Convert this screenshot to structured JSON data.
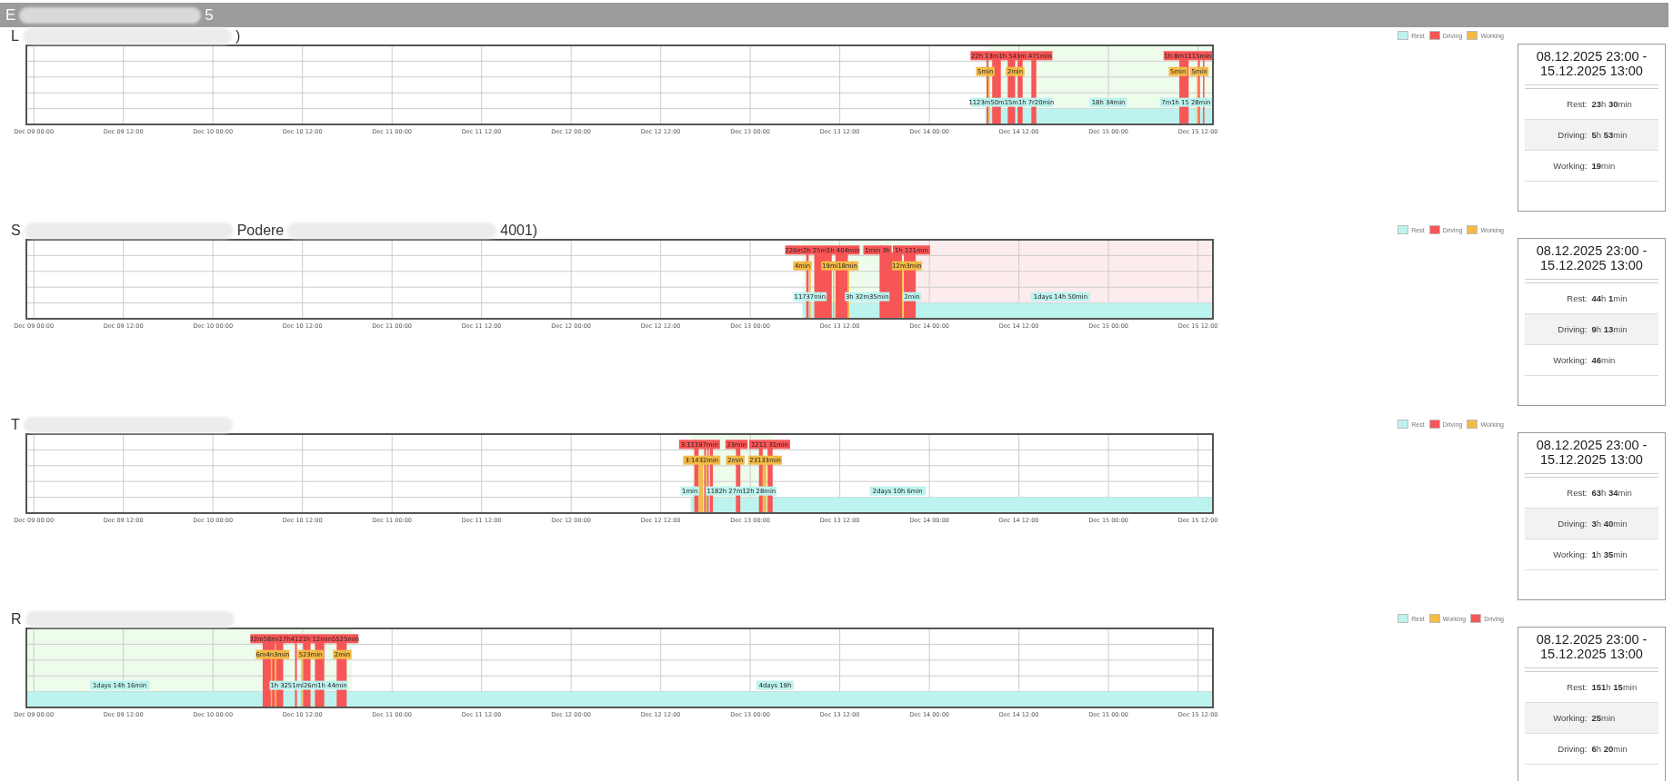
{
  "header": {
    "title": [
      {
        "kind": "text",
        "text": "E"
      },
      {
        "kind": "redaction"
      },
      {
        "kind": "text",
        "text": "5"
      }
    ]
  },
  "sections": [
    {
      "title": [
        {
          "kind": "text",
          "text": "L"
        },
        {
          "kind": "redaction"
        },
        {
          "kind": "text",
          "text": ")"
        }
      ],
      "legend": [
        {
          "kind": "rest",
          "label": "Rest"
        },
        {
          "kind": "driving",
          "label": "Driving"
        },
        {
          "kind": "working",
          "label": "Working"
        }
      ],
      "timeline": {
        "ticks": [
          "Dec 09 00:00",
          "Dec 09 12:00",
          "Dec 10 00:00",
          "Dec 10 12:00",
          "Dec 11 00:00",
          "Dec 11 12:00",
          "Dec 12 00:00",
          "Dec 12 12:00",
          "Dec 13 00:00",
          "Dec 13 12:00",
          "Dec 14 00:00",
          "Dec 14 12:00",
          "Dec 15 00:00",
          "Dec 15 12:00"
        ],
        "labels": [
          {
            "kind": "driving",
            "text": "22h 13m1h 543m 471min"
          },
          {
            "kind": "driving",
            "text": "1h 8m1115min"
          },
          {
            "kind": "working",
            "text": "5min"
          },
          {
            "kind": "working",
            "text": "2min"
          },
          {
            "kind": "working",
            "text": "5min"
          },
          {
            "kind": "working",
            "text": "5min"
          },
          {
            "kind": "rest",
            "text": "1123m50m15m1h 7r20min"
          },
          {
            "kind": "rest",
            "text": "18h 34min"
          },
          {
            "kind": "rest",
            "text": "7m1h 15 28min"
          }
        ]
      },
      "summary": {
        "period": "08.12.2025 23:00 - 15.12.2025 13:00",
        "rows": [
          {
            "label": "Rest:",
            "value": "**23**h **30**min"
          },
          {
            "label": "Driving:",
            "value": "**5**h **53**min"
          },
          {
            "label": "Working:",
            "value": "**19**min"
          }
        ]
      }
    },
    {
      "title": [
        {
          "kind": "text",
          "text": "S"
        },
        {
          "kind": "redaction"
        },
        {
          "kind": "text",
          "text": "Podere"
        },
        {
          "kind": "redaction"
        },
        {
          "kind": "text",
          "text": "4001)"
        }
      ],
      "legend": [
        {
          "kind": "rest",
          "label": "Rest"
        },
        {
          "kind": "driving",
          "label": "Driving"
        },
        {
          "kind": "working",
          "label": "Working"
        }
      ],
      "timeline": {
        "ticks": [
          "Dec 09 00:00",
          "Dec 09 12:00",
          "Dec 10 00:00",
          "Dec 10 12:00",
          "Dec 11 00:00",
          "Dec 11 12:00",
          "Dec 12 00:00",
          "Dec 12 12:00",
          "Dec 13 00:00",
          "Dec 13 12:00",
          "Dec 14 00:00",
          "Dec 14 12:00",
          "Dec 15 00:00",
          "Dec 15 12:00"
        ],
        "labels": [
          {
            "kind": "driving",
            "text": "226m2h 25m1h 404min"
          },
          {
            "kind": "driving",
            "text": "1min"
          },
          {
            "kind": "driving",
            "text": "3h"
          },
          {
            "kind": "driving",
            "text": "1h 121min"
          },
          {
            "kind": "working",
            "text": "4min"
          },
          {
            "kind": "working",
            "text": "19mi18min"
          },
          {
            "kind": "working",
            "text": "12m3min"
          },
          {
            "kind": "rest",
            "text": "11737min"
          },
          {
            "kind": "rest",
            "text": "3h 32m35min"
          },
          {
            "kind": "rest",
            "text": "2min"
          },
          {
            "kind": "rest",
            "text": "1days 14h 50min"
          }
        ]
      },
      "summary": {
        "period": "08.12.2025 23:00 - 15.12.2025 13:00",
        "rows": [
          {
            "label": "Rest:",
            "value": "**44**h **1**min"
          },
          {
            "label": "Driving:",
            "value": "**9**h **13**min"
          },
          {
            "label": "Working:",
            "value": "**46**min"
          }
        ]
      }
    },
    {
      "title": [
        {
          "kind": "text",
          "text": "T"
        },
        {
          "kind": "redaction"
        }
      ],
      "legend": [
        {
          "kind": "rest",
          "label": "Rest"
        },
        {
          "kind": "driving",
          "label": "Driving"
        },
        {
          "kind": "working",
          "label": "Working"
        }
      ],
      "timeline": {
        "ticks": [
          "Dec 09 00:00",
          "Dec 09 12:00",
          "Dec 10 00:00",
          "Dec 10 12:00",
          "Dec 11 00:00",
          "Dec 11 12:00",
          "Dec 12 00:00",
          "Dec 12 12:00",
          "Dec 13 00:00",
          "Dec 13 12:00",
          "Dec 14 00:00",
          "Dec 14 12:00",
          "Dec 15 00:00",
          "Dec 15 12:00"
        ],
        "labels": [
          {
            "kind": "driving",
            "text": "3:11197min"
          },
          {
            "kind": "driving",
            "text": "23min"
          },
          {
            "kind": "driving",
            "text": "1211 31min"
          },
          {
            "kind": "working",
            "text": "3:1432min"
          },
          {
            "kind": "working",
            "text": "2min"
          },
          {
            "kind": "working",
            "text": "23133min"
          },
          {
            "kind": "rest",
            "text": "1min"
          },
          {
            "kind": "rest",
            "text": "1182h 27m12h 28min"
          },
          {
            "kind": "rest",
            "text": "2days 10h 6min"
          }
        ]
      },
      "summary": {
        "period": "08.12.2025 23:00 - 15.12.2025 13:00",
        "rows": [
          {
            "label": "Rest:",
            "value": "**63**h **34**min"
          },
          {
            "label": "Driving:",
            "value": "**3**h **40**min"
          },
          {
            "label": "Working:",
            "value": "**1**h **35**min"
          }
        ]
      }
    },
    {
      "title": [
        {
          "kind": "text",
          "text": "R"
        },
        {
          "kind": "redaction"
        }
      ],
      "legend": [
        {
          "kind": "rest",
          "label": "Rest"
        },
        {
          "kind": "working",
          "label": "Working"
        },
        {
          "kind": "driving",
          "label": "Driving"
        }
      ],
      "timeline": {
        "ticks": [
          "Dec 09 00:00",
          "Dec 09 12:00",
          "Dec 10 00:00",
          "Dec 10 12:00",
          "Dec 11 00:00",
          "Dec 11 12:00",
          "Dec 12 00:00",
          "Dec 12 12:00",
          "Dec 13 00:00",
          "Dec 13 12:00",
          "Dec 14 00:00",
          "Dec 14 12:00",
          "Dec 15 00:00",
          "Dec 15 12:00"
        ],
        "labels": [
          {
            "kind": "driving",
            "text": "32m58mi17h4121h 12min5525min"
          },
          {
            "kind": "working",
            "text": "6m4n3min"
          },
          {
            "kind": "working",
            "text": "523min"
          },
          {
            "kind": "working",
            "text": "2min"
          },
          {
            "kind": "rest",
            "text": "1days 14h 16min"
          },
          {
            "kind": "rest",
            "text": "1h 3251ml26m1h 44min"
          },
          {
            "kind": "rest",
            "text": "4days 19h"
          }
        ]
      },
      "summary": {
        "period": "08.12.2025 23:00 - 15.12.2025 13:00",
        "rows": [
          {
            "label": "Rest:",
            "value": "**151**h **15**min"
          },
          {
            "label": "Working:",
            "value": "**25**min"
          },
          {
            "label": "Driving:",
            "value": "**6**h **20**min"
          }
        ]
      }
    }
  ]
}
